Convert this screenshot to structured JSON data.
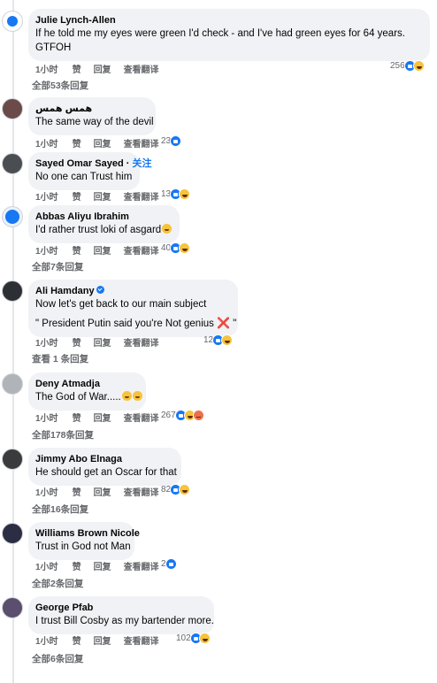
{
  "comments": [
    {
      "author": "Julie Lynch-Allen",
      "text": "If he told me my eyes were green I'd check - and I've had green eyes for 64 years.",
      "text_b": "GTFOH",
      "time": "1小时",
      "like": "赞",
      "reply": "回复",
      "translate": "查看翻译",
      "react_count": "256",
      "replies": "全部53条回复"
    },
    {
      "author": "همس همس",
      "text": "The same way of the devil",
      "time": "1小时",
      "like": "赞",
      "reply": "回复",
      "translate": "查看翻译",
      "react_count": "23"
    },
    {
      "author": "Sayed Omar Sayed",
      "follow": "关注",
      "text": "No one can Trust him",
      "time": "1小时",
      "like": "赞",
      "reply": "回复",
      "translate": "查看翻译",
      "react_count": "13"
    },
    {
      "author": "Abbas Aliyu Ibrahim",
      "text": "I'd rather trust loki of asgard",
      "time": "1小时",
      "like": "赞",
      "reply": "回复",
      "translate": "查看翻译",
      "react_count": "40",
      "replies": "全部7条回复"
    },
    {
      "author": "Ali Hamdany",
      "text": "Now let's get back to our main subject",
      "text_b": "\" President Putin said you're Not genius",
      "text_b_tail": "\"",
      "time": "1小时",
      "like": "赞",
      "reply": "回复",
      "translate": "查看翻译",
      "react_count": "12",
      "replies": "查看 1 条回复"
    },
    {
      "author": "Deny Atmadja",
      "text": "The God of War.....",
      "time": "1小时",
      "like": "赞",
      "reply": "回复",
      "translate": "查看翻译",
      "react_count": "267",
      "replies": "全部178条回复"
    },
    {
      "author": "Jimmy Abo Elnaga",
      "text": "He should get an Oscar for that",
      "time": "1小时",
      "like": "赞",
      "reply": "回复",
      "translate": "查看翻译",
      "react_count": "82",
      "replies": "全部16条回复"
    },
    {
      "author": "Williams Brown Nicole",
      "text": "Trust in God not Man",
      "time": "1小时",
      "like": "赞",
      "reply": "回复",
      "translate": "查看翻译",
      "react_count": "2",
      "replies": "全部2条回复"
    },
    {
      "author": "George Pfab",
      "text": "I trust Bill Cosby as my bartender more.",
      "time": "1小时",
      "like": "赞",
      "reply": "回复",
      "translate": "查看翻译",
      "react_count": "102",
      "replies": "全部6条回复"
    }
  ],
  "icons": {
    "like": "like-reaction-icon",
    "haha": "haha-reaction-icon",
    "angry": "angry-reaction-icon",
    "verified": "verified-badge-icon",
    "cross": "❌"
  },
  "colors": {
    "bubble": "#f0f2f5",
    "muted": "#65676b",
    "accent": "#1877f2"
  }
}
